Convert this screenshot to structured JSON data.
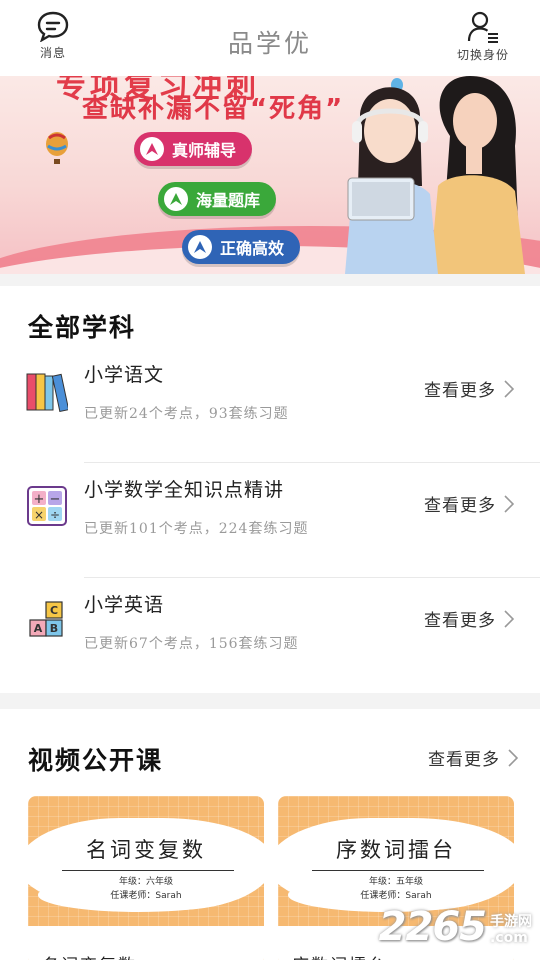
{
  "header": {
    "messages_label": "消息",
    "title": "品学优",
    "switch_label": "切换身份"
  },
  "banner": {
    "top_text": "专项复习冲刺",
    "headline": "查缺补漏不留“死角”",
    "pills": [
      "真师辅导",
      "海量题库",
      "正确高效"
    ],
    "colors": {
      "pill1": "#d8326c",
      "pill2": "#3aa83a",
      "pill3": "#2f64b6",
      "accent": "#e03848"
    }
  },
  "subjects": {
    "title": "全部学科",
    "items": [
      {
        "name": "小学语文",
        "meta": "已更新24个考点，93套练习题",
        "more": "查看更多",
        "icon": "books-icon"
      },
      {
        "name": "小学数学全知识点精讲",
        "meta": "已更新101个考点，224套练习题",
        "more": "查看更多",
        "icon": "math-icon"
      },
      {
        "name": "小学英语",
        "meta": "已更新67个考点，156套练习题",
        "more": "查看更多",
        "icon": "abc-blocks-icon"
      }
    ]
  },
  "videos": {
    "title": "视频公开课",
    "more": "查看更多",
    "cards": [
      {
        "title": "名词变复数",
        "grade": "年级：六年级",
        "teacher": "任课老师：Sarah",
        "caption": "名词变复数"
      },
      {
        "title": "序数词擂台",
        "grade": "年级：五年级",
        "teacher": "任课老师：Sarah",
        "caption": "序数词擂台"
      }
    ]
  },
  "watermark": {
    "number": "2265",
    "line1": "手游网",
    "line2": ".com"
  }
}
